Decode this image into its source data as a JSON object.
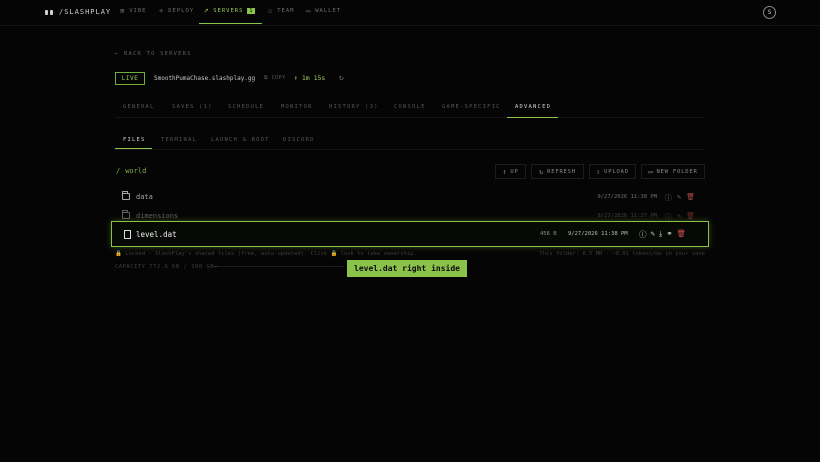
{
  "brand": "/SLASHPLAY",
  "nav": {
    "vibe": "VIBE",
    "deploy": "DEPLOY",
    "servers": "SERVERS",
    "servers_badge": "1",
    "team": "TEAM",
    "wallet": "WALLET"
  },
  "avatar_letter": "S",
  "back_label": "← BACK TO SERVERS",
  "server": {
    "status": "LIVE",
    "domain": "SmoothPumaChase.slashplay.gg",
    "copy_label": "COPY",
    "timer": "↑ 1m 15s"
  },
  "tabs": [
    "GENERAL",
    "SAVES (1)",
    "SCHEDULE",
    "MONITOR",
    "HISTORY (3)",
    "CONSOLE",
    "GAME-SPECIFIC",
    "ADVANCED"
  ],
  "subtabs": [
    "FILES",
    "TERMINAL",
    "LAUNCH & BOOT",
    "DISCORD"
  ],
  "files": {
    "path_slash": "/",
    "path": "world",
    "buttons": {
      "up": "UP",
      "refresh": "REFRESH",
      "upload": "UPLOAD",
      "new_folder": "NEW FOLDER"
    },
    "rows": [
      {
        "name": "data",
        "date": "9/27/2026 11:38 PM"
      },
      {
        "name": "dimensions",
        "date": "9/27/2026 11:37 PM"
      }
    ],
    "highlighted": {
      "name": "level.dat",
      "size": "456 B",
      "date": "9/27/2026 11:38 PM"
    },
    "note": "🔒 Locked · SlashPlay's shared files (free, auto-updated). Click 🔒 lock to take ownership.",
    "folder_info": "This folder: 6.5 MB · ~0.01 tokens/mo in your save",
    "capacity": "CAPACITY 772.6 KB / 100 GB",
    "capacity_fraction": 0.0
  },
  "callout": "level.dat right inside",
  "colors": {
    "accent": "#8bc34a",
    "danger": "#d05050",
    "background": "#050505"
  },
  "icons": {
    "vibe": "grid-icon",
    "deploy": "plus-icon",
    "servers": "rocket-icon",
    "team": "people-icon",
    "wallet": "wallet-icon",
    "row_actions": [
      "info-icon",
      "edit-icon",
      "download-icon",
      "link-icon",
      "trash-icon"
    ]
  }
}
